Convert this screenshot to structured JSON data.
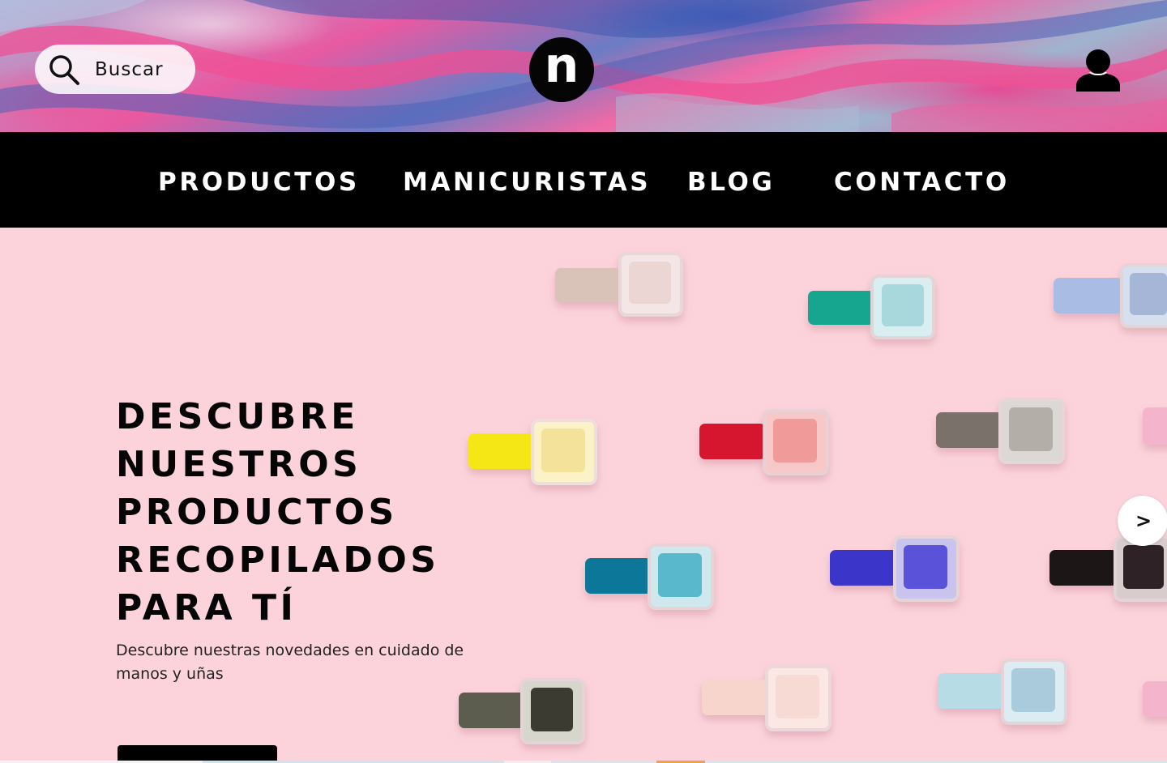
{
  "header": {
    "search": {
      "label": "Buscar",
      "icon": "search-icon"
    },
    "logo": {
      "text": "n"
    },
    "account": {
      "icon": "user-icon"
    }
  },
  "nav": {
    "items": [
      {
        "label": "PRODUCTOS"
      },
      {
        "label": "MANICURISTAS"
      },
      {
        "label": "BLOG"
      },
      {
        "label": "CONTACTO"
      }
    ]
  },
  "hero": {
    "title_lines": [
      "DESCUBRE",
      "NUESTROS",
      "PRODUCTOS",
      "RECOPILADOS",
      "PARA TÍ"
    ],
    "subtitle": "Descubre nuestras novedades en cuidado de manos y uñas",
    "next_label": ">"
  },
  "colors": {
    "nav_bg": "#000000",
    "hero_bg": "#fcd3db",
    "text": "#050505"
  }
}
